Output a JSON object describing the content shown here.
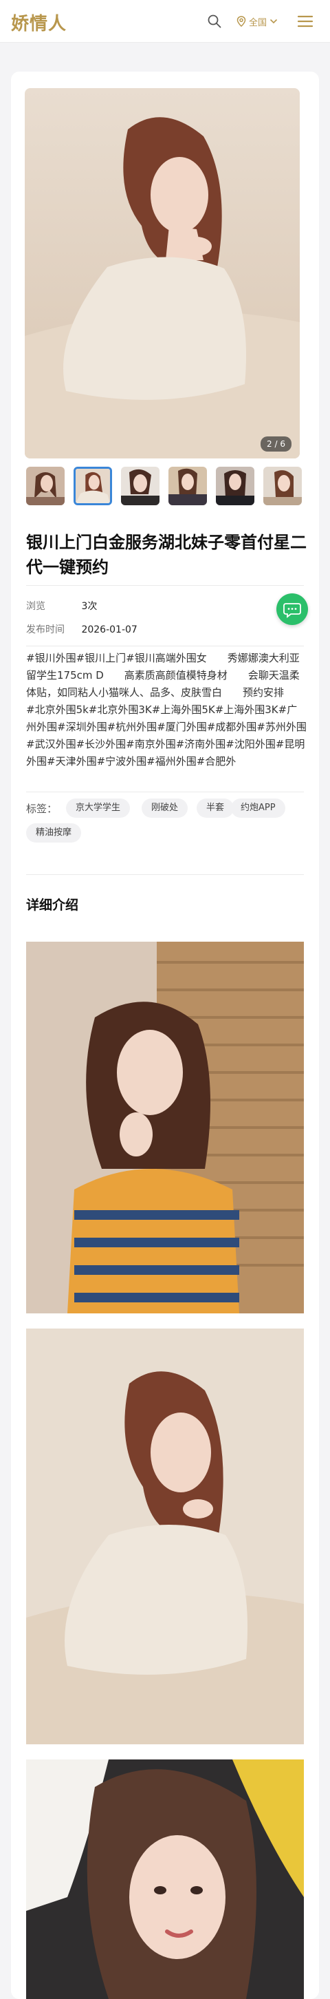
{
  "header": {
    "logo": "娇情人",
    "search_icon": "search-icon",
    "location_icon": "map-pin-icon",
    "location_label": "全国",
    "chevron_icon": "chevron-down-icon",
    "menu_icon": "hamburger-menu-icon",
    "accent_color": "#b8974d"
  },
  "gallery": {
    "counter": "2 / 6",
    "current_index": 2,
    "total": 6,
    "thumbnails_count": 6,
    "active_thumbnail": 2
  },
  "post": {
    "title": "银川上门白金服务湖北妹子零首付星二代一键预约",
    "meta": [
      {
        "key": "浏览",
        "value": "3次"
      },
      {
        "key": "发布时间",
        "value": "2026-01-07"
      }
    ],
    "description": "#银川外围#银川上门#银川高端外围女　　秀娜娜澳大利亚留学生175cm D　　高素质高颜值模特身材　　会聊天温柔体贴，如同粘人小猫咪人、品多、皮肤雪白　　预约安排　　#北京外围5k#北京外围3K#上海外围5K#上海外围3K#广州外围#深圳外围#杭州外围#厦门外围#成都外围#苏州外围#武汉外围#长沙外围#南京外围#济南外围#沈阳外围#昆明外围#天津外围#宁波外围#福州外围#合肥外",
    "tags_label": "标签：",
    "tags": [
      "京大学学生",
      "刚破处",
      "半套",
      "约炮APP",
      "精油按摩"
    ]
  },
  "chat": {
    "icon": "chat-bubble-icon",
    "color": "#2bbf6a"
  },
  "details": {
    "section_title": "详细介绍"
  }
}
